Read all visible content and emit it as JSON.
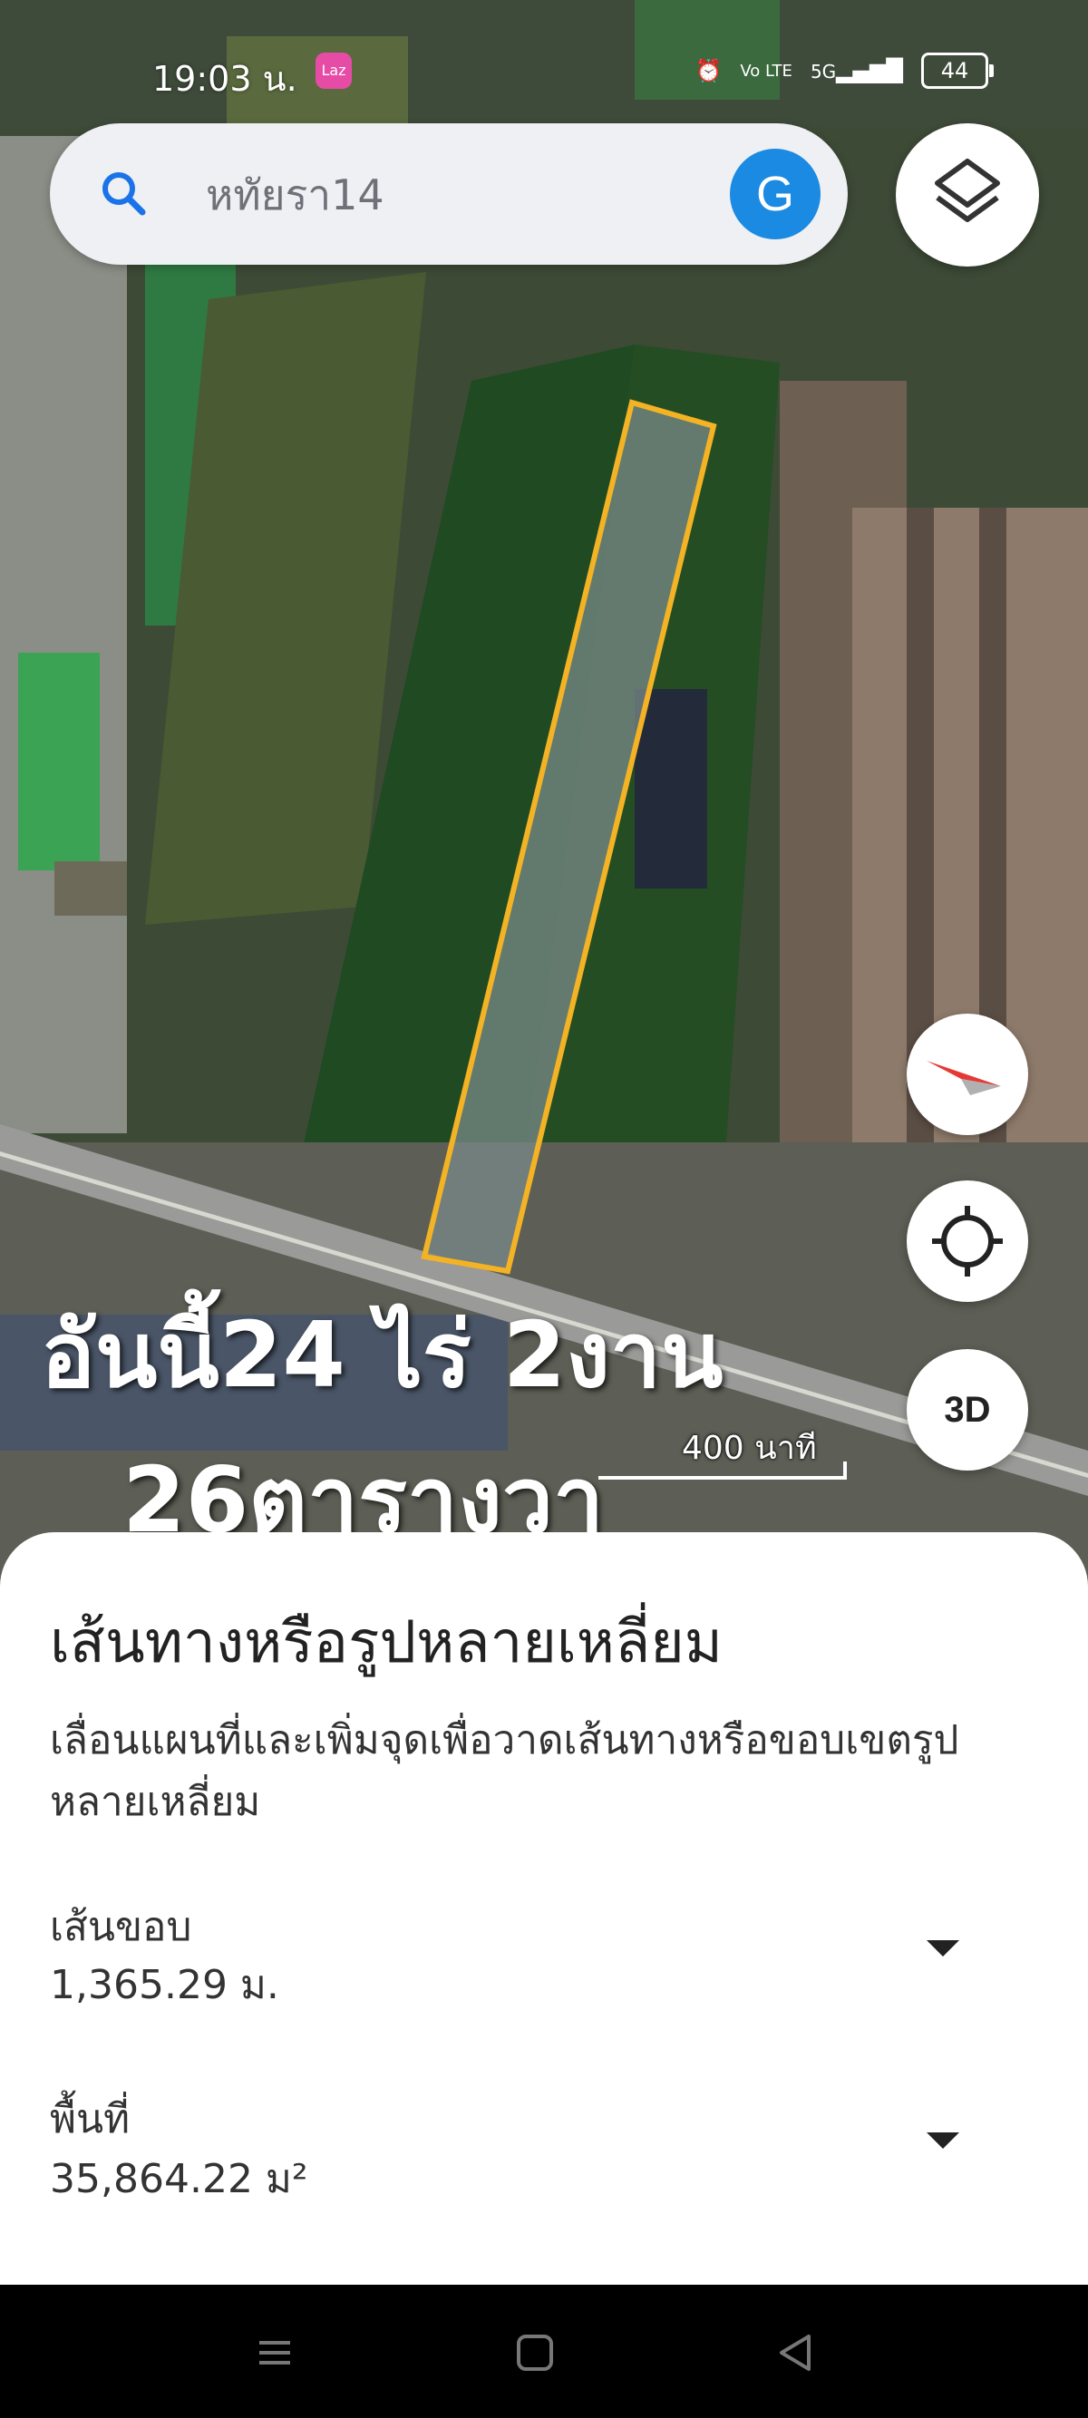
{
  "status_bar": {
    "time": "19:03 น.",
    "app_badge": "Laz",
    "network": "5G",
    "volte": "Vo LTE",
    "battery": "44"
  },
  "search": {
    "placeholder": "หทัยรา14",
    "account_initial": "G"
  },
  "map": {
    "overlay_line1": "อันนี้24 ไร่ 2งาน",
    "overlay_line2": "26ตารางวา",
    "scale_label": "400 นาที",
    "button_3d": "3D",
    "polygon_color": "#f3b324"
  },
  "sheet": {
    "title": "เส้นทางหรือรูปหลายเหลี่ยม",
    "description": "เลื่อนแผนที่และเพิ่มจุดเพื่อวาดเส้นทางหรือขอบเขตรูปหลายเหลี่ยม",
    "perimeter_label": "เส้นขอบ",
    "perimeter_value": "1,365.29 ม.",
    "area_label": "พื้นที่",
    "area_value": "35,864.22 ม²"
  },
  "navbar": {
    "icons": [
      "menu-icon",
      "home-icon",
      "back-icon"
    ]
  }
}
